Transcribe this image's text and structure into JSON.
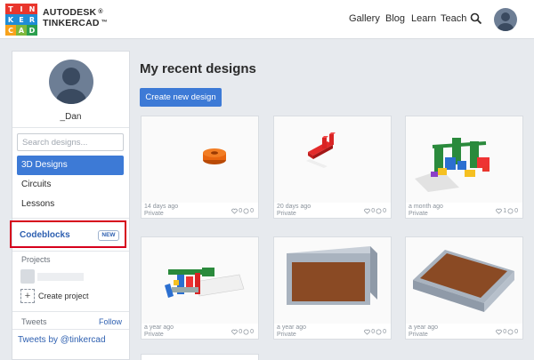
{
  "header": {
    "logo_letters": [
      "T",
      "I",
      "N",
      "K",
      "E",
      "R",
      "C",
      "A",
      "D"
    ],
    "logo_colors": [
      "#e9362d",
      "#e9362d",
      "#e9362d",
      "#1f8dd6",
      "#1f8dd6",
      "#1f8dd6",
      "#f7a21b",
      "#7eb83d",
      "#2b9f4e"
    ],
    "brand_line1": "AUTODESK",
    "brand_line2": "TINKERCAD",
    "brand_mark1": "®",
    "brand_mark2": "™",
    "nav": [
      "Gallery",
      "Blog",
      "Learn",
      "Teach"
    ]
  },
  "sidebar": {
    "username": "_Dan",
    "search_placeholder": "Search designs...",
    "items": [
      "3D Designs",
      "Circuits",
      "Lessons"
    ],
    "active_item": "3D Designs",
    "codeblocks_label": "Codeblocks",
    "codeblocks_badge": "NEW",
    "projects_label": "Projects",
    "create_project_label": "Create project",
    "plus_symbol": "+",
    "tweets_label": "Tweets",
    "follow_label": "Follow",
    "tweets_by_label": "Tweets by @tinkercad"
  },
  "main": {
    "title": "My recent designs",
    "create_button": "Create new design",
    "cards": [
      {
        "date": "14 days ago",
        "privacy": "Private",
        "likes": "0",
        "comments": "0",
        "thumb": "orange-ring"
      },
      {
        "date": "20 days ago",
        "privacy": "Private",
        "likes": "0",
        "comments": "0",
        "thumb": "red-bracket"
      },
      {
        "date": "a month ago",
        "privacy": "Private",
        "likes": "1",
        "comments": "0",
        "thumb": "color-assembly"
      },
      {
        "date": "a year ago",
        "privacy": "Private",
        "likes": "0",
        "comments": "0",
        "thumb": "mechanism"
      },
      {
        "date": "a year ago",
        "privacy": "Private",
        "likes": "0",
        "comments": "0",
        "thumb": "brown-box"
      },
      {
        "date": "a year ago",
        "privacy": "Private",
        "likes": "0",
        "comments": "0",
        "thumb": "brown-slab"
      }
    ]
  },
  "colors": {
    "accent": "#3d7ad6",
    "highlight_border": "#d6001c",
    "link": "#2d5fb0"
  }
}
